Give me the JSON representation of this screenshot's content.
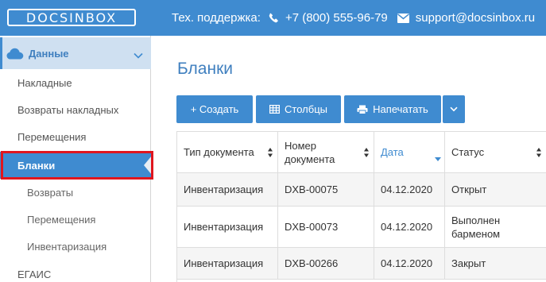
{
  "header": {
    "logo_text": "DOCSINBOX",
    "support_label": "Тех. поддержка:",
    "phone_icon": "phone-icon",
    "phone": "+7 (800) 555-96-79",
    "email_icon": "envelope-icon",
    "email": "support@docsinbox.ru"
  },
  "sidebar": {
    "section": {
      "icon": "cloud-icon",
      "label": "Данные",
      "chevron": "chevron-down-icon"
    },
    "items": [
      {
        "label": "Накладные"
      },
      {
        "label": "Возвраты накладных"
      },
      {
        "label": "Перемещения"
      },
      {
        "label": "Бланки",
        "active": true
      },
      {
        "label": "Возвраты"
      },
      {
        "label": "Перемещения"
      },
      {
        "label": "Инвентаризация"
      },
      {
        "label": "ЕГАИС"
      }
    ]
  },
  "main": {
    "title": "Бланки",
    "toolbar": {
      "create_label": "+ Создать",
      "columns_icon": "table-icon",
      "columns_label": "Столбцы",
      "print_icon": "printer-icon",
      "print_label": "Напечатать",
      "more_icon": "chevron-down-icon"
    },
    "table": {
      "columns": [
        {
          "label": "Тип документа",
          "sorted": false
        },
        {
          "label": "Номер документа",
          "sorted": false
        },
        {
          "label": "Дата",
          "sorted": true
        },
        {
          "label": "Статус",
          "sorted": false
        }
      ],
      "rows": [
        {
          "type": "Инвентаризация",
          "number": "DXB-00075",
          "date": "04.12.2020",
          "status": "Открыт"
        },
        {
          "type": "Инвентаризация",
          "number": "DXB-00073",
          "date": "04.12.2020",
          "status": "Выполнен барменом"
        },
        {
          "type": "Инвентаризация",
          "number": "DXB-00266",
          "date": "04.12.2020",
          "status": "Закрыт"
        }
      ]
    }
  },
  "colors": {
    "accent": "#3f8bd0",
    "highlight_border": "#e0161e",
    "sidebar_section_bg": "#cfe0f1"
  }
}
